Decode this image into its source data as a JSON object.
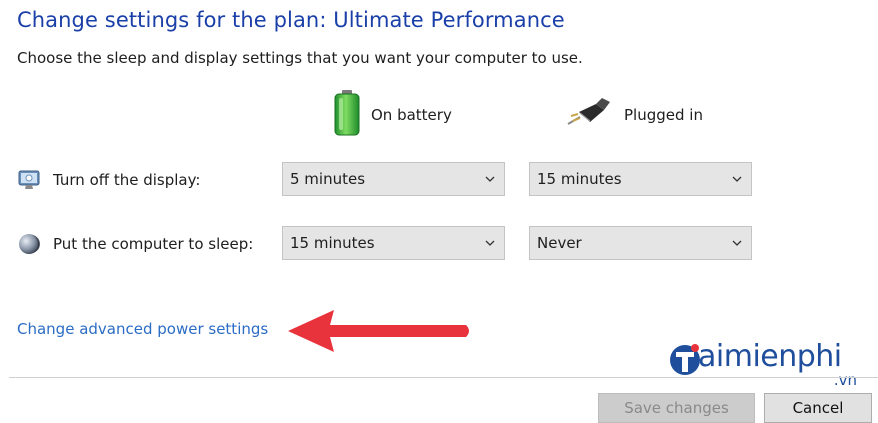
{
  "header": {
    "title": "Change settings for the plan: Ultimate Performance",
    "subtitle": "Choose the sleep and display settings that you want your computer to use."
  },
  "columns": {
    "battery": {
      "label": "On battery",
      "icon": "battery-icon"
    },
    "plugged": {
      "label": "Plugged in",
      "icon": "power-plug-icon"
    }
  },
  "rows": [
    {
      "label": "Turn off the display:",
      "icon": "monitor-icon",
      "battery_value": "5 minutes",
      "plugged_value": "15 minutes"
    },
    {
      "label": "Put the computer to sleep:",
      "icon": "moon-sleep-icon",
      "battery_value": "15 minutes",
      "plugged_value": "Never"
    }
  ],
  "links": {
    "advanced": "Change advanced power settings"
  },
  "buttons": {
    "save": "Save changes",
    "cancel": "Cancel"
  },
  "watermark": {
    "text": "aimienphi",
    "suffix": ".vn"
  },
  "colors": {
    "title": "#1a3fa8",
    "link": "#2b6cc4",
    "arrow": "#e8333c",
    "battery": "#3fb34a"
  }
}
